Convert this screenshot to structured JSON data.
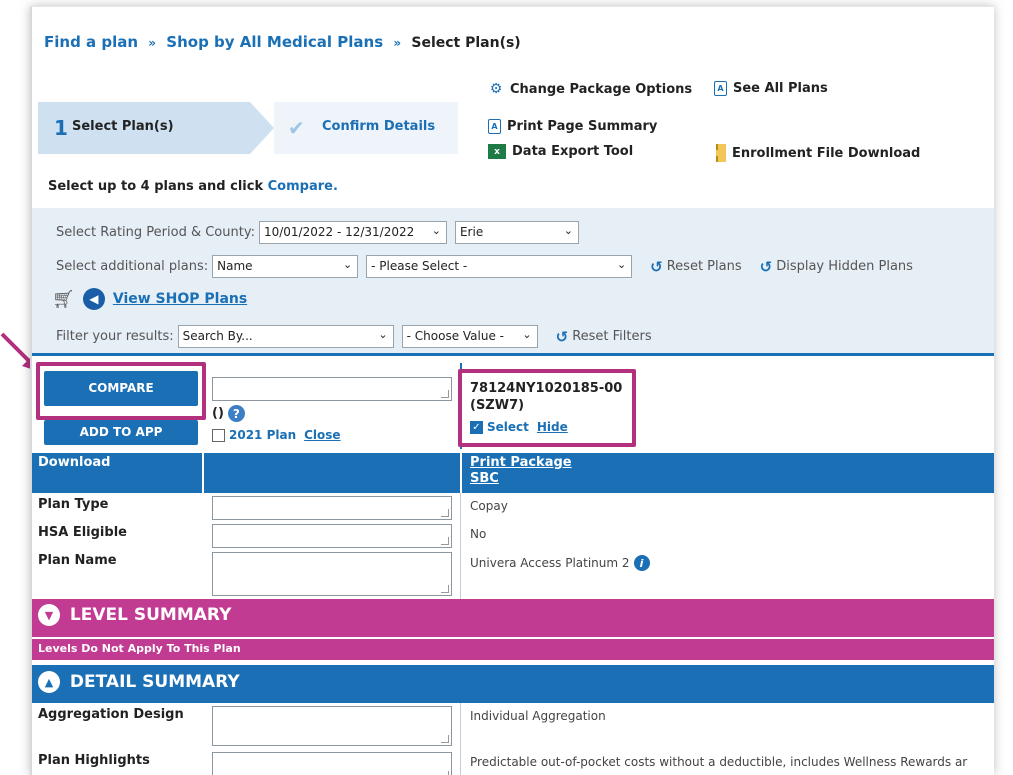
{
  "breadcrumb": {
    "item1": "Find a plan",
    "item2": "Shop by All Medical Plans",
    "current": "Select Plan(s)",
    "separator": "»"
  },
  "steps": {
    "step1_num": "1",
    "step1_label": "Select Plan(s)",
    "step2_label": "Confirm Details"
  },
  "tools": {
    "change_package": "Change Package Options",
    "see_all_plans": "See All Plans",
    "print_page_summary": "Print Page Summary",
    "data_export": "Data Export Tool",
    "enrollment_file": "Enrollment File Download"
  },
  "instructions": {
    "text": "Select up to 4 plans and click",
    "link": "Compare."
  },
  "filters": {
    "rating_label": "Select Rating Period & County:",
    "rating_period": "10/01/2022 - 12/31/2022",
    "county": "Erie",
    "additional_label": "Select additional plans:",
    "additional_by": "Name",
    "additional_value": "- Please Select -",
    "reset_plans": "Reset Plans",
    "display_hidden": "Display Hidden Plans",
    "view_shop": "View SHOP Plans",
    "filter_label": "Filter your results:",
    "search_by": "Search By...",
    "choose_value": "- Choose Value -",
    "reset_filters": "Reset Filters"
  },
  "actions": {
    "compare": "COMPARE",
    "add_to_app": "ADD TO APP",
    "empty_parens": "()",
    "year_plan": "2021 Plan",
    "close": "Close"
  },
  "plan": {
    "id_line1": "78124NY1020185-00",
    "id_line2": "(SZW7)",
    "select": "Select",
    "hide": "Hide",
    "selected": true
  },
  "table": {
    "download_header": "Download",
    "print_package": "Print Package",
    "sbc": "SBC",
    "rows": [
      {
        "label": "Plan Type",
        "value": "Copay"
      },
      {
        "label": "HSA Eligible",
        "value": "No"
      },
      {
        "label": "Plan Name",
        "value": "Univera Access Platinum 2"
      }
    ]
  },
  "level_summary": {
    "title": "LEVEL SUMMARY",
    "note": "Levels Do Not Apply To This Plan"
  },
  "detail_summary": {
    "title": "DETAIL SUMMARY",
    "rows": [
      {
        "label": "Aggregation Design",
        "value": "Individual Aggregation"
      },
      {
        "label": "Plan Highlights",
        "value": "Predictable out-of-pocket costs without a deductible, includes Wellness Rewards ar"
      }
    ]
  },
  "colors": {
    "primary_blue": "#1a6fb5",
    "magenta": "#c13b93",
    "highlight": "#b2307e"
  }
}
